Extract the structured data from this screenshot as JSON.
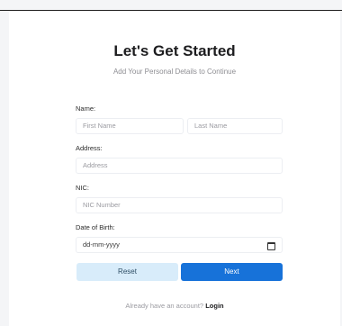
{
  "header": {
    "title": "Let's Get Started",
    "subtitle": "Add Your Personal Details to Continue"
  },
  "form": {
    "name_label": "Name:",
    "first_name_placeholder": "First Name",
    "last_name_placeholder": "Last Name",
    "address_label": "Address:",
    "address_placeholder": "Address",
    "nic_label": "NIC:",
    "nic_placeholder": "NIC Number",
    "dob_label": "Date of Birth:",
    "dob_value": "dd-mm-yyyy"
  },
  "actions": {
    "reset_label": "Reset",
    "next_label": "Next"
  },
  "footer": {
    "prompt": "Already have an account?",
    "login_label": "Login"
  },
  "colors": {
    "primary": "#1772d9",
    "secondary": "#d8ecfa"
  }
}
